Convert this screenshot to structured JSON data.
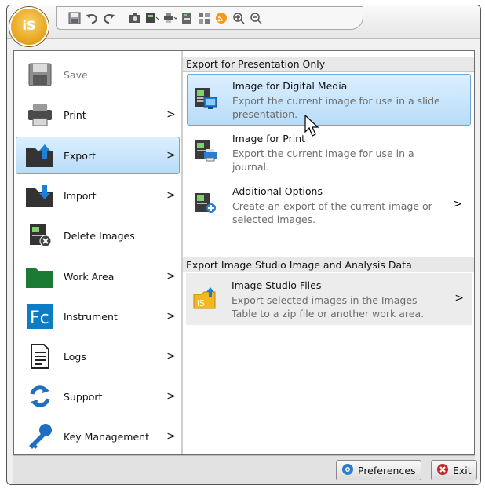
{
  "app": {
    "orb_label": "iS"
  },
  "qat": {
    "icons": [
      "save-icon",
      "undo-icon",
      "redo-icon",
      "camera-icon",
      "image-dropdown-icon",
      "print-dropdown-icon",
      "report-icon",
      "grid-icon",
      "rss-icon",
      "zoom-in-icon",
      "zoom-out-icon"
    ]
  },
  "left_menu": {
    "items": [
      {
        "label": "Save",
        "icon": "save-icon",
        "disabled": true,
        "has_submenu": false
      },
      {
        "label": "Print",
        "icon": "printer-icon",
        "has_submenu": true
      },
      {
        "label": "Export",
        "icon": "export-folder-icon",
        "selected": true,
        "has_submenu": true
      },
      {
        "label": "Import",
        "icon": "import-folder-icon",
        "has_submenu": true
      },
      {
        "label": "Delete Images",
        "icon": "delete-images-icon",
        "has_submenu": false
      },
      {
        "label": "Work Area",
        "icon": "folder-icon",
        "has_submenu": true
      },
      {
        "label": "Instrument",
        "icon": "instrument-fc-icon",
        "has_submenu": true
      },
      {
        "label": "Logs",
        "icon": "document-icon",
        "has_submenu": true
      },
      {
        "label": "Support",
        "icon": "support-sync-icon",
        "has_submenu": true
      },
      {
        "label": "Key Management",
        "icon": "key-icon",
        "has_submenu": true
      }
    ],
    "chevron": ">"
  },
  "right_panel": {
    "section1": {
      "header": "Export for Presentation Only",
      "items": [
        {
          "title": "Image for Digital Media",
          "desc": "Export the current image for use in a slide presentation.",
          "icon": "digital-media-icon",
          "highlighted": true
        },
        {
          "title": "Image for Print",
          "desc": "Export the current image for use in a journal.",
          "icon": "image-print-icon"
        },
        {
          "title": "Additional Options",
          "desc": "Create an export of the current image or selected images.",
          "icon": "additional-options-icon",
          "chevron": ">"
        }
      ]
    },
    "section2": {
      "header": "Export Image Studio Image and Analysis Data",
      "items": [
        {
          "title": "Image Studio Files",
          "desc": "Export selected images in the Images Table to a zip file or another work area.",
          "icon": "image-studio-files-icon",
          "chevron": ">"
        }
      ]
    }
  },
  "footer": {
    "preferences_label": "Preferences",
    "exit_label": "Exit"
  }
}
